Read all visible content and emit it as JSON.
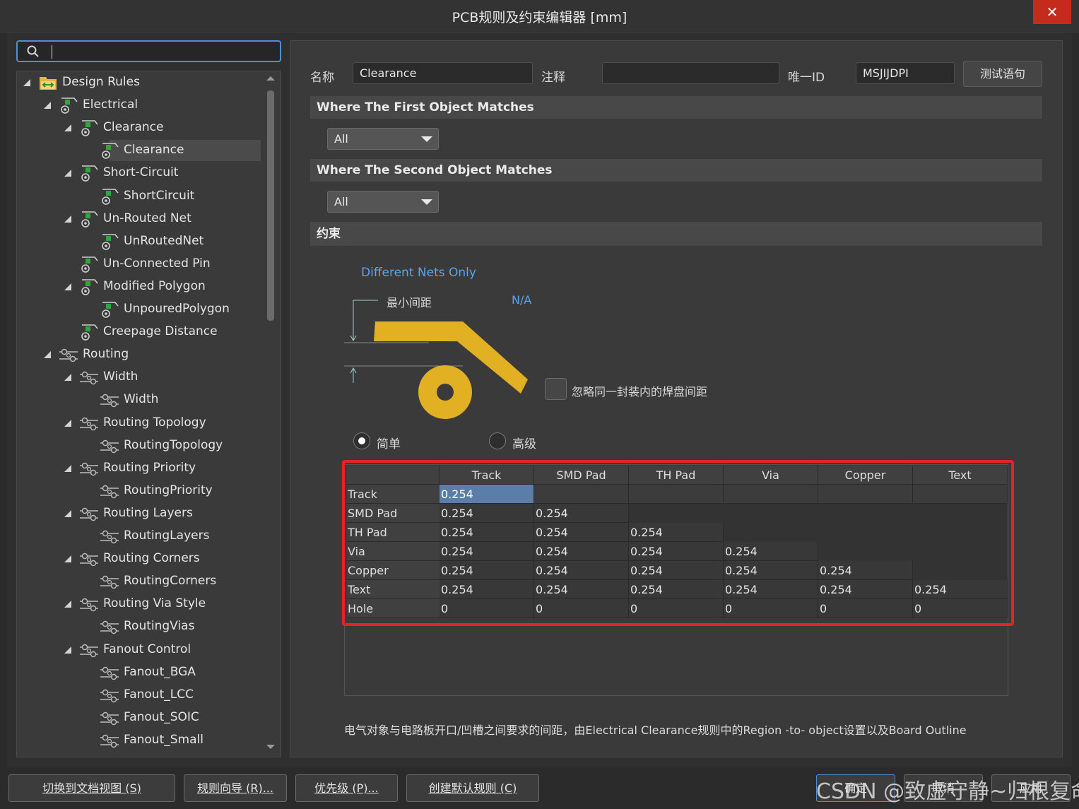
{
  "window": {
    "title": "PCB规则及约束编辑器 [mm]",
    "close_glyph": "✕"
  },
  "search": {
    "value": ""
  },
  "tree": [
    {
      "label": "Design Rules",
      "level": 0,
      "expanded": true,
      "icon": "folder-rules-icon"
    },
    {
      "label": "Electrical",
      "level": 1,
      "expanded": true,
      "icon": "electrical-rule-icon"
    },
    {
      "label": "Clearance",
      "level": 2,
      "expanded": true,
      "icon": "electrical-rule-icon"
    },
    {
      "label": "Clearance",
      "level": 3,
      "selected": true,
      "icon": "electrical-rule-icon"
    },
    {
      "label": "Short-Circuit",
      "level": 2,
      "expanded": true,
      "icon": "electrical-rule-icon"
    },
    {
      "label": "ShortCircuit",
      "level": 3,
      "icon": "electrical-rule-icon"
    },
    {
      "label": "Un-Routed Net",
      "level": 2,
      "expanded": true,
      "icon": "electrical-rule-icon"
    },
    {
      "label": "UnRoutedNet",
      "level": 3,
      "icon": "electrical-rule-icon"
    },
    {
      "label": "Un-Connected Pin",
      "level": 2,
      "icon": "electrical-rule-icon"
    },
    {
      "label": "Modified Polygon",
      "level": 2,
      "expanded": true,
      "icon": "electrical-rule-icon"
    },
    {
      "label": "UnpouredPolygon",
      "level": 3,
      "icon": "electrical-rule-icon"
    },
    {
      "label": "Creepage Distance",
      "level": 2,
      "icon": "electrical-rule-icon"
    },
    {
      "label": "Routing",
      "level": 1,
      "expanded": true,
      "icon": "routing-rule-icon"
    },
    {
      "label": "Width",
      "level": 2,
      "expanded": true,
      "icon": "routing-rule-icon"
    },
    {
      "label": "Width",
      "level": 3,
      "icon": "routing-rule-icon"
    },
    {
      "label": "Routing Topology",
      "level": 2,
      "expanded": true,
      "icon": "routing-rule-icon"
    },
    {
      "label": "RoutingTopology",
      "level": 3,
      "icon": "routing-rule-icon"
    },
    {
      "label": "Routing Priority",
      "level": 2,
      "expanded": true,
      "icon": "routing-rule-icon"
    },
    {
      "label": "RoutingPriority",
      "level": 3,
      "icon": "routing-rule-icon"
    },
    {
      "label": "Routing Layers",
      "level": 2,
      "expanded": true,
      "icon": "routing-rule-icon"
    },
    {
      "label": "RoutingLayers",
      "level": 3,
      "icon": "routing-rule-icon"
    },
    {
      "label": "Routing Corners",
      "level": 2,
      "expanded": true,
      "icon": "routing-rule-icon"
    },
    {
      "label": "RoutingCorners",
      "level": 3,
      "icon": "routing-rule-icon"
    },
    {
      "label": "Routing Via Style",
      "level": 2,
      "expanded": true,
      "icon": "routing-rule-icon"
    },
    {
      "label": "RoutingVias",
      "level": 3,
      "icon": "routing-rule-icon"
    },
    {
      "label": "Fanout Control",
      "level": 2,
      "expanded": true,
      "icon": "routing-rule-icon"
    },
    {
      "label": "Fanout_BGA",
      "level": 3,
      "icon": "routing-rule-icon"
    },
    {
      "label": "Fanout_LCC",
      "level": 3,
      "icon": "routing-rule-icon"
    },
    {
      "label": "Fanout_SOIC",
      "level": 3,
      "icon": "routing-rule-icon"
    },
    {
      "label": "Fanout_Small",
      "level": 3,
      "icon": "routing-rule-icon"
    }
  ],
  "rule": {
    "name_label": "名称",
    "name_value": "Clearance",
    "comment_label": "注释",
    "comment_value": "",
    "uid_label": "唯一ID",
    "uid_value": "MSJIJDPI",
    "test_button": "测试语句"
  },
  "first_match": {
    "title": "Where The First Object Matches",
    "value": "All"
  },
  "second_match": {
    "title": "Where The Second Object Matches",
    "value": "All"
  },
  "constraints": {
    "title": "约束",
    "net_scope": "Different Nets Only",
    "min_clearance_label": "最小间距",
    "min_clearance_value": "N/A",
    "ignore_pads_label": "忽略同一封装内的焊盘间距",
    "ignore_pads_checked": false,
    "mode_simple": "简单",
    "mode_advanced": "高级",
    "mode_selected": "simple",
    "accent_color": "#e2b123"
  },
  "matrix": {
    "columns": [
      "Track",
      "SMD Pad",
      "TH Pad",
      "Via",
      "Copper",
      "Text"
    ],
    "rows": [
      {
        "label": "Track",
        "values": [
          "0.254"
        ]
      },
      {
        "label": "SMD Pad",
        "values": [
          "0.254",
          "0.254"
        ]
      },
      {
        "label": "TH Pad",
        "values": [
          "0.254",
          "0.254",
          "0.254"
        ]
      },
      {
        "label": "Via",
        "values": [
          "0.254",
          "0.254",
          "0.254",
          "0.254"
        ]
      },
      {
        "label": "Copper",
        "values": [
          "0.254",
          "0.254",
          "0.254",
          "0.254",
          "0.254"
        ]
      },
      {
        "label": "Text",
        "values": [
          "0.254",
          "0.254",
          "0.254",
          "0.254",
          "0.254",
          "0.254"
        ]
      },
      {
        "label": "Hole",
        "values": [
          "0",
          "0",
          "0",
          "0",
          "0",
          "0"
        ]
      }
    ],
    "highlight_color": "#e3222a"
  },
  "footnote": "电气对象与电路板开口/凹槽之间要求的间距，由Electrical Clearance规则中的Region -to- object设置以及Board Outline",
  "footer_buttons": {
    "switch_doc": "切换到文档视图 (S)",
    "rule_wizard": "规则向导 (R)...",
    "priority": "优先级 (P)...",
    "create_default": "创建默认规则 (C)",
    "ok": "确定",
    "cancel": "取消",
    "apply": "应用"
  },
  "watermark": "CSDN @致虚守静~归根复命"
}
